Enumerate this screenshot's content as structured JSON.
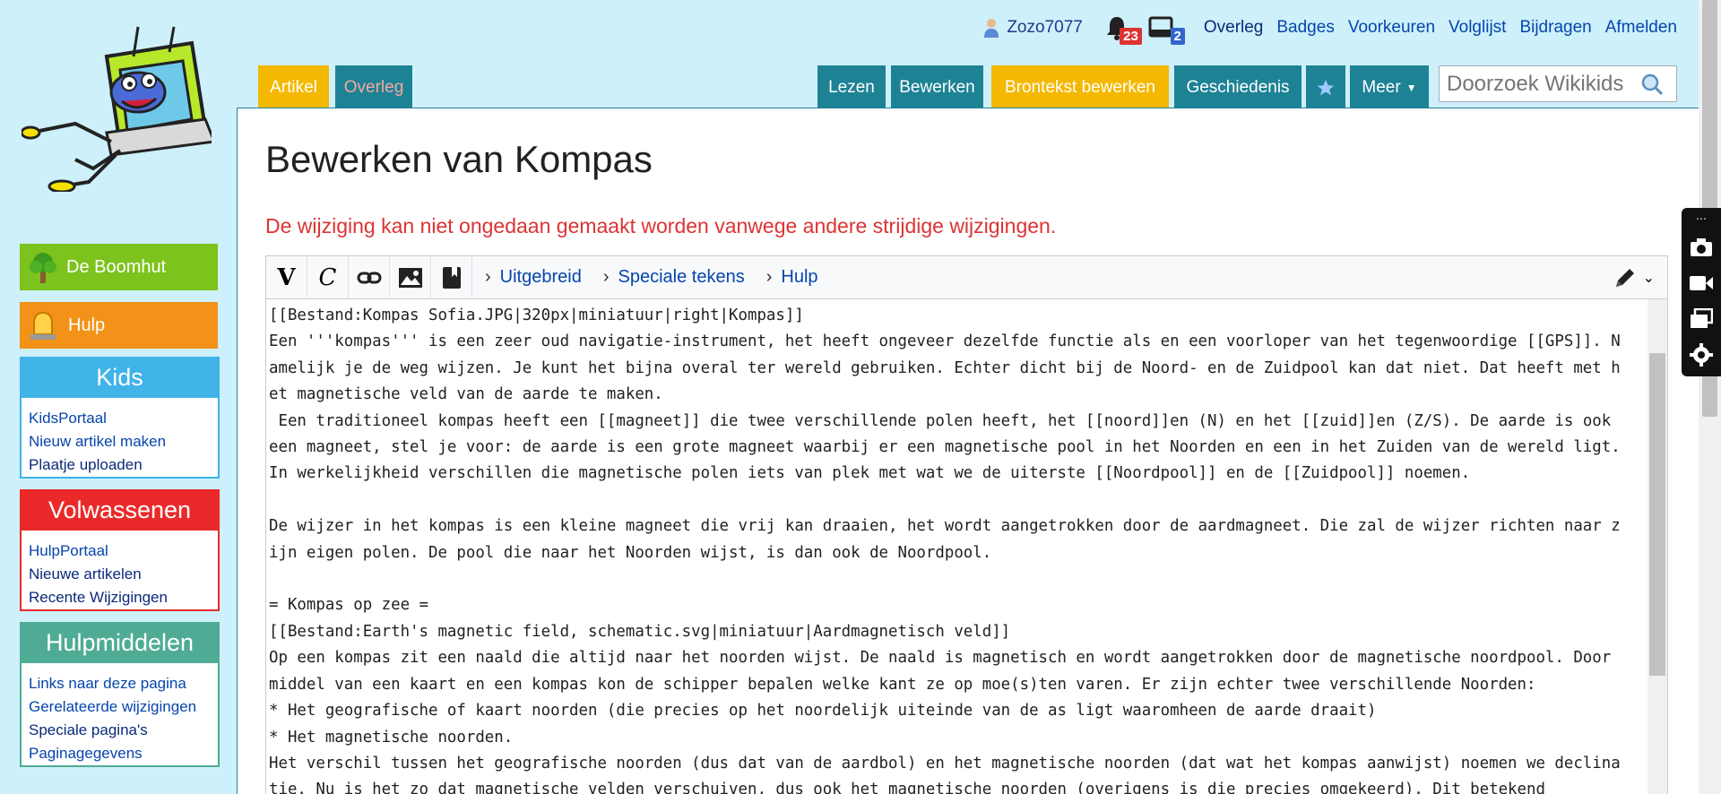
{
  "personal": {
    "username": "Zozo7077",
    "notifications_count": "23",
    "messages_count": "2",
    "links": [
      "Overleg",
      "Badges",
      "Voorkeuren",
      "Volglijst",
      "Bijdragen",
      "Afmelden"
    ]
  },
  "sidebar": {
    "boomhut": "De Boomhut",
    "hulp": "Hulp",
    "kids": {
      "title": "Kids",
      "items": [
        "KidsPortaal",
        "Nieuw artikel maken",
        "Plaatje uploaden"
      ]
    },
    "volwassenen": {
      "title": "Volwassenen",
      "items": [
        "HulpPortaal",
        "Nieuwe artikelen",
        "Recente Wijzigingen"
      ]
    },
    "hulpmiddelen": {
      "title": "Hulpmiddelen",
      "items": [
        "Links naar deze pagina",
        "Gerelateerde wijzigingen",
        "Speciale pagina's",
        "Paginagegevens"
      ]
    }
  },
  "tabs": {
    "artikel": "Artikel",
    "overleg": "Overleg",
    "lezen": "Lezen",
    "bewerken": "Bewerken",
    "brontekst": "Brontekst bewerken",
    "geschiedenis": "Geschiedenis",
    "meer": "Meer"
  },
  "search": {
    "placeholder": "Doorzoek Wikikids"
  },
  "content": {
    "title": "Bewerken van Kompas",
    "warning": "De wijziging kan niet ongedaan gemaakt worden vanwege andere strijdige wijzigingen."
  },
  "toolbar": {
    "sections": [
      "Uitgebreid",
      "Speciale tekens",
      "Hulp"
    ]
  },
  "wikitext": "[[Bestand:Kompas Sofia.JPG|320px|miniatuur|right|Kompas]]\nEen '''kompas''' is een zeer oud navigatie-instrument, het heeft ongeveer dezelfde functie als en een voorloper van het tegenwoordige [[GPS]]. Namelijk je de weg wijzen. Je kunt het bijna overal ter wereld gebruiken. Echter dicht bij de Noord- en de Zuidpool kan dat niet. Dat heeft met het magnetische veld van de aarde te maken.\n Een traditioneel kompas heeft een [[magneet]] die twee verschillende polen heeft, het [[noord]]en (N) en het [[zuid]]en (Z/S). De aarde is ook een magneet, stel je voor: de aarde is een grote magneet waarbij er een magnetische pool in het Noorden en een in het Zuiden van de wereld ligt. In werkelijkheid verschillen die magnetische polen iets van plek met wat we de uiterste [[Noordpool]] en de [[Zuidpool]] noemen.\n\nDe wijzer in het kompas is een kleine magneet die vrij kan draaien, het wordt aangetrokken door de aardmagneet. Die zal de wijzer richten naar zijn eigen polen. De pool die naar het Noorden wijst, is dan ook de Noordpool.\n\n= Kompas op zee =\n[[Bestand:Earth's magnetic field, schematic.svg|miniatuur|Aardmagnetisch veld]]\nOp een kompas zit een naald die altijd naar het noorden wijst. De naald is magnetisch en wordt aangetrokken door de magnetische noordpool. Door middel van een kaart en een kompas kon de schipper bepalen welke kant ze op moe(s)ten varen. Er zijn echter twee verschillende Noorden:\n* Het geografische of kaart noorden (die precies op het noordelijk uiteinde van de as ligt waaromheen de aarde draait)\n* Het magnetische noorden.\nHet verschil tussen het geografische noorden (dus dat van de aardbol) en het magnetische noorden (dat wat het kompas aanwijst) noemen we declinatie. Nu is het zo dat magnetische velden verschuiven, dus ook het magnetische noorden (overigens is die precies omgekeerd). Dit betekend"
}
